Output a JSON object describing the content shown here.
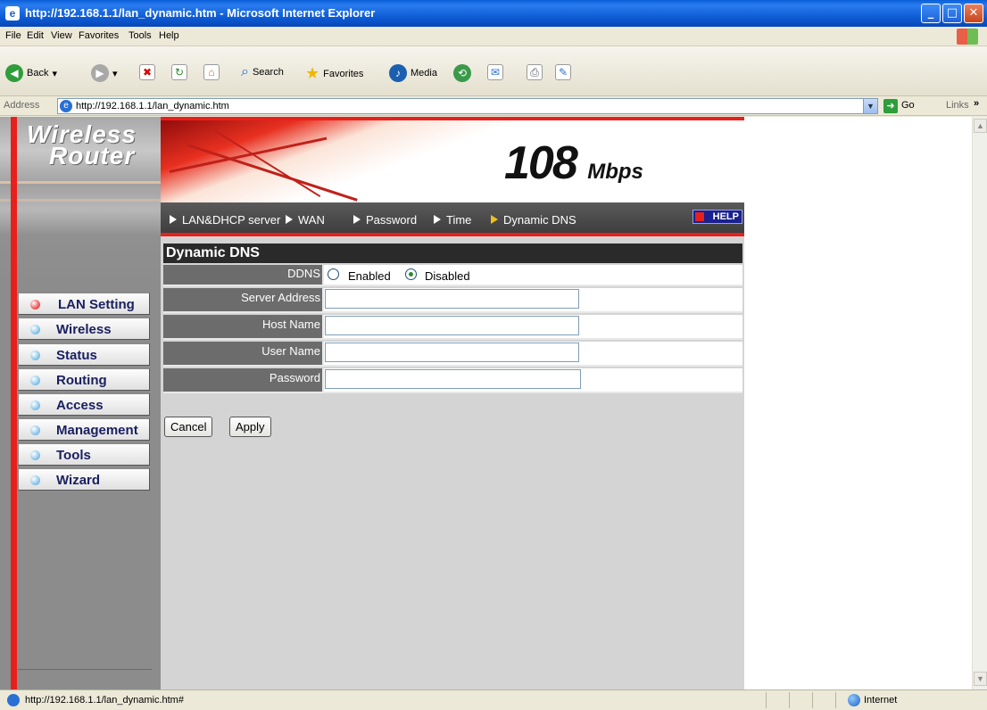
{
  "window": {
    "title": "http://192.168.1.1/lan_dynamic.htm - Microsoft Internet Explorer"
  },
  "menubar": {
    "items": [
      "File",
      "Edit",
      "View",
      "Favorites",
      "Tools",
      "Help"
    ]
  },
  "toolbar": {
    "back": "Back",
    "search": "Search",
    "favorites": "Favorites",
    "media": "Media"
  },
  "addressbar": {
    "label": "Address",
    "url": "http://192.168.1.1/lan_dynamic.htm",
    "go": "Go",
    "links": "Links"
  },
  "brand": {
    "line1": "Wireless",
    "line2": "Router",
    "speed": "108",
    "speed_unit": "Mbps"
  },
  "sidebar": {
    "items": [
      {
        "label": "LAN Setting",
        "active": true
      },
      {
        "label": "Wireless",
        "active": false
      },
      {
        "label": "Status",
        "active": false
      },
      {
        "label": "Routing",
        "active": false
      },
      {
        "label": "Access",
        "active": false
      },
      {
        "label": "Management",
        "active": false
      },
      {
        "label": "Tools",
        "active": false
      },
      {
        "label": "Wizard",
        "active": false
      }
    ]
  },
  "subnav": {
    "items": [
      "LAN&DHCP server",
      "WAN",
      "Password",
      "Time",
      "Dynamic DNS"
    ],
    "selected": "Dynamic DNS",
    "help": "HELP"
  },
  "form": {
    "title": "Dynamic DNS",
    "ddns_label": "DDNS",
    "ddns_enabled": "Enabled",
    "ddns_disabled": "Disabled",
    "ddns_value": "Disabled",
    "server_address_label": "Server Address",
    "server_address_value": "",
    "host_name_label": "Host Name",
    "host_name_value": "",
    "user_name_label": "User Name",
    "user_name_value": "",
    "password_label": "Password",
    "password_value": "",
    "cancel": "Cancel",
    "apply": "Apply"
  },
  "statusbar": {
    "text": "http://192.168.1.1/lan_dynamic.htm#",
    "zone": "Internet"
  },
  "colors": {
    "accent_red": "#e8201c",
    "nav_text": "#1a2060",
    "titlebar_blue": "#0a5fd8"
  }
}
